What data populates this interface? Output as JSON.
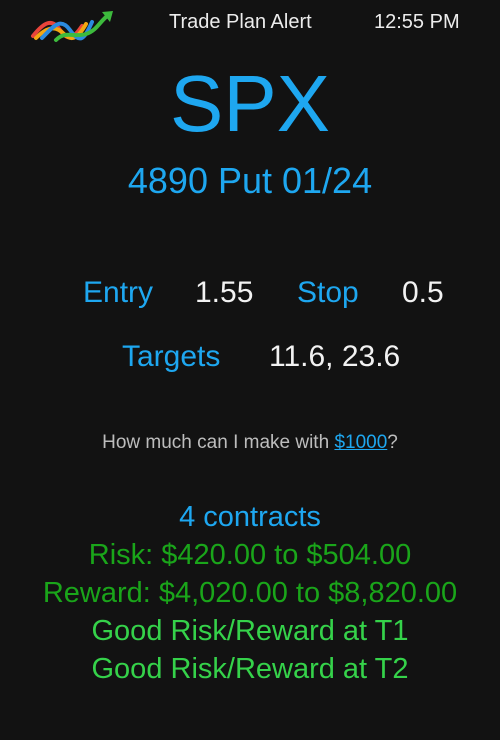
{
  "header": {
    "title": "Trade Plan Alert",
    "time": "12:55 PM",
    "logo_icon": "trend-logo-icon"
  },
  "trade": {
    "symbol": "SPX",
    "contract": "4890 Put 01/24",
    "entry_label": "Entry",
    "entry_value": "1.55",
    "stop_label": "Stop",
    "stop_value": "0.5",
    "targets_label": "Targets",
    "targets_value": "11.6, 23.6"
  },
  "calculator": {
    "question_prefix": "How much can I make with ",
    "amount_link": "$1000",
    "question_suffix": "?"
  },
  "results": {
    "contracts": "4 contracts",
    "risk": "Risk: $420.00 to $504.00",
    "reward": "Reward: $4,020.00 to $8,820.00",
    "t1": "Good Risk/Reward at T1",
    "t2": "Good Risk/Reward at T2"
  },
  "colors": {
    "background": "#121212",
    "accent_blue": "#1ea7f0",
    "dark_green": "#1aa51a",
    "light_green": "#35d24a"
  }
}
